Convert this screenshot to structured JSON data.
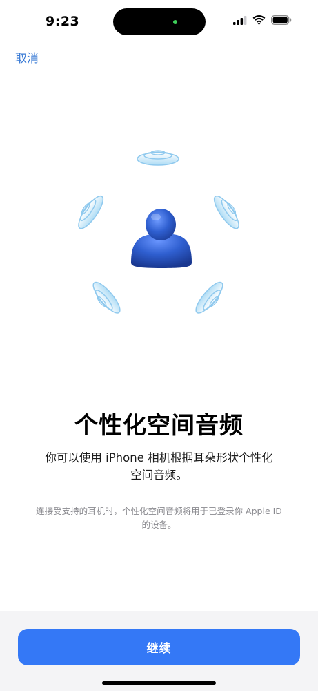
{
  "status_bar": {
    "time": "9:23",
    "icons": [
      "cellular-signal-icon",
      "wifi-icon",
      "battery-icon"
    ],
    "privacy_indicator_color": "#3ecf59"
  },
  "nav": {
    "cancel_label": "取消"
  },
  "illustration": {
    "icon": "spatial-audio-head-icon",
    "person_color": "#2f5fd0",
    "wave_color": "#9fd3f2"
  },
  "content": {
    "title": "个性化空间音频",
    "subtitle_line1": "你可以使用 iPhone 相机根据耳朵形状个性化",
    "subtitle_line2": "空间音频。",
    "footnote_line1": "连接受支持的耳机时，个性化空间音频将用于已登录你 Apple ID",
    "footnote_line2": "的设备。"
  },
  "footer": {
    "continue_label": "继续"
  },
  "colors": {
    "accent": "#3478f6",
    "link": "#3a7bd5",
    "footnote": "#8a8a8f",
    "panel_bg": "#f4f4f6"
  }
}
